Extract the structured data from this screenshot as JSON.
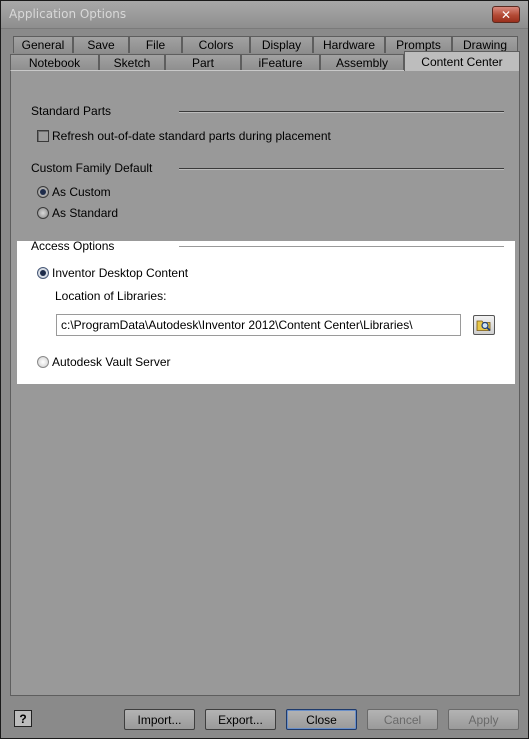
{
  "window": {
    "title": "Application Options",
    "close_glyph": "✕"
  },
  "tabs_row1": [
    "General",
    "Save",
    "File",
    "Colors",
    "Display",
    "Hardware",
    "Prompts",
    "Drawing"
  ],
  "tabs_row2": [
    "Notebook",
    "Sketch",
    "Part",
    "iFeature",
    "Assembly",
    "Content Center"
  ],
  "active_tab": "Content Center",
  "standard_parts": {
    "heading": "Standard Parts",
    "refresh_label": "Refresh out-of-date standard parts during placement",
    "refresh_checked": false
  },
  "custom_family_default": {
    "heading": "Custom Family Default",
    "options": [
      "As Custom",
      "As Standard"
    ],
    "selected": "As Custom"
  },
  "access_options": {
    "heading": "Access Options",
    "desktop_label": "Inventor Desktop Content",
    "location_label": "Location of Libraries:",
    "location_value": "c:\\ProgramData\\Autodesk\\Inventor 2012\\Content Center\\Libraries\\",
    "vault_label": "Autodesk Vault Server",
    "selected": "Inventor Desktop Content"
  },
  "buttons": {
    "help": "?",
    "import": "Import...",
    "export": "Export...",
    "close": "Close",
    "cancel": "Cancel",
    "apply": "Apply"
  },
  "icons": {
    "browse": "browse-folder-icon",
    "help": "help-icon",
    "close": "close-icon"
  }
}
